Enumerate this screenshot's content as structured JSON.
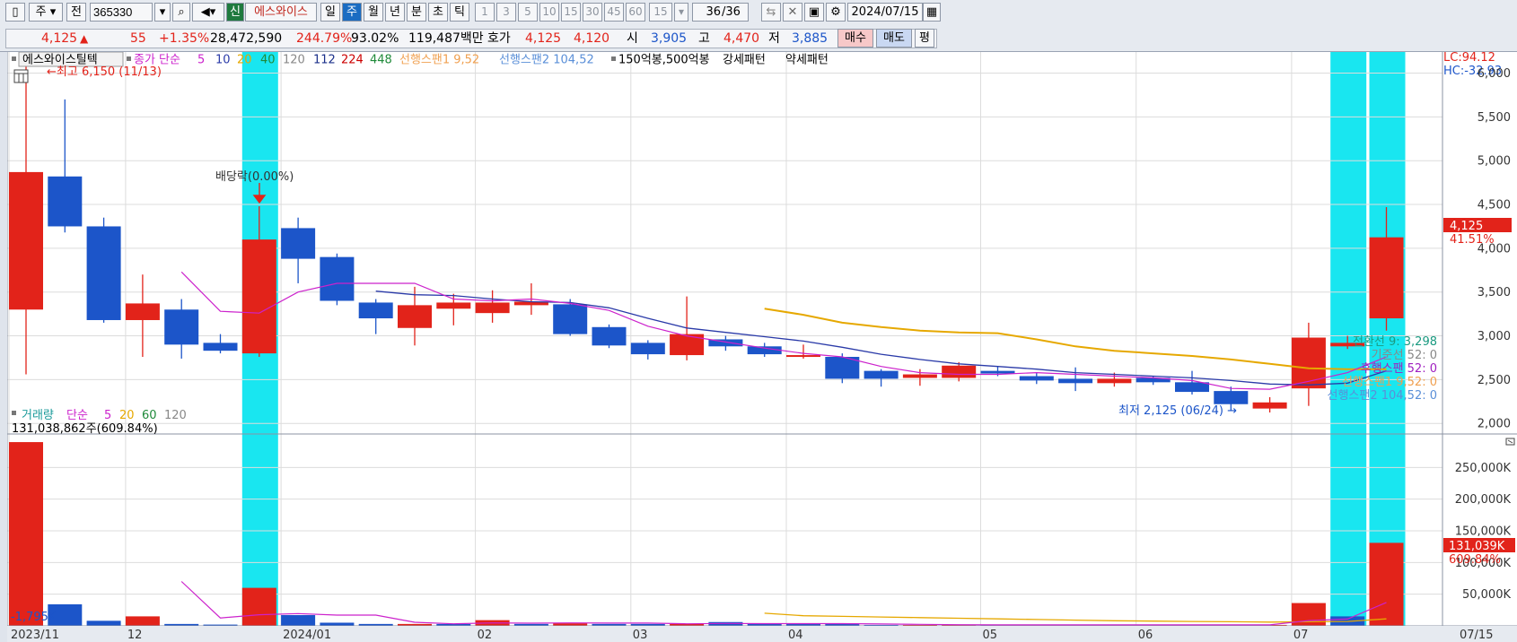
{
  "toolbar": {
    "period_type": "주",
    "prev_label": "전",
    "code": "365330",
    "credit_badge": "신",
    "stock_name": "에스와이스",
    "periods": [
      "일",
      "주",
      "월",
      "년",
      "분",
      "초",
      "틱"
    ],
    "active_period": "주",
    "minute_presets": [
      "1",
      "3",
      "5",
      "10",
      "15",
      "30",
      "45",
      "60"
    ],
    "minute_value": "15",
    "page_current": "36",
    "page_total": "/36",
    "date": "2024/07/15"
  },
  "quote": {
    "price": "4,125",
    "change_arrow": "▲",
    "change": "55",
    "change_pct": "+1.35%",
    "volume": "28,472,590",
    "volume_ratio": "244.79%",
    "turnover": "93.02%",
    "amount": "119,487백만",
    "ask_label": "호가",
    "ask": "4,125",
    "bid": "4,120",
    "open_label": "시",
    "open": "3,905",
    "high_label": "고",
    "high": "4,470",
    "low_label": "저",
    "low": "3,885",
    "buy_label": "매수",
    "sell_label": "매도",
    "eval_label": "평"
  },
  "price_legend": {
    "name": "에스와이스틸텍",
    "ma_label": "종가 단순",
    "ma_periods": [
      "5",
      "10",
      "20",
      "40",
      "120",
      "112",
      "224",
      "448"
    ],
    "span1": "선행스팬1 9,52",
    "span2": "선행스팬2 104,52",
    "pattern1": "150억봉,500억봉",
    "pattern2": "강세패턴",
    "pattern3": "약세패턴"
  },
  "price_annotations": {
    "high_mark": "←최고 6,150 (11/13)",
    "dividend": "배당락(0.00%)",
    "low_mark": "최저 2,125 (06/24) →",
    "lc": "LC:94.12",
    "hc": "HC:-32.93",
    "price_tag": "4,125",
    "price_pct": "41.51%",
    "ichimoku": [
      "전환선 9: 3,298",
      "기준선 52: 0",
      "후행스팬 52: 0",
      "선행스팬1 9,52: 0",
      "선행스팬2 104,52: 0"
    ]
  },
  "volume_legend": {
    "label": "거래량",
    "ma_label": "단순",
    "ma_periods": [
      "5",
      "20",
      "60",
      "120"
    ],
    "current": "131,038,862주(609.84%)",
    "corner_value": "-1,795K",
    "tag": "131,039K",
    "tag_pct": "609.84%"
  },
  "x_axis": {
    "labels": [
      "2023/11",
      "12",
      "2024/01",
      "02",
      "03",
      "04",
      "05",
      "06",
      "07"
    ],
    "last": "07/15"
  },
  "colors": {
    "up": "#e2231a",
    "down": "#1c55c9",
    "highlight": "#19e6f0",
    "ma5": "#cc22cc",
    "ma10": "#2a3aa8",
    "ma20": "#e6a800"
  },
  "chart_data": [
    {
      "type": "candlestick",
      "title": "에스와이스틸텍",
      "x": [
        "2023-11-13",
        "2023-11-20",
        "2023-11-27",
        "2023-12-04",
        "2023-12-11",
        "2023-12-18",
        "2023-12-26",
        "2024-01-02",
        "2024-01-08",
        "2024-01-15",
        "2024-01-22",
        "2024-01-29",
        "2024-02-05",
        "2024-02-13",
        "2024-02-19",
        "2024-02-26",
        "2024-03-04",
        "2024-03-11",
        "2024-03-18",
        "2024-03-25",
        "2024-04-01",
        "2024-04-08",
        "2024-04-15",
        "2024-04-22",
        "2024-04-29",
        "2024-05-06",
        "2024-05-13",
        "2024-05-20",
        "2024-05-27",
        "2024-06-03",
        "2024-06-10",
        "2024-06-17",
        "2024-06-24",
        "2024-07-01",
        "2024-07-08",
        "2024-07-15"
      ],
      "open": [
        3300,
        4820,
        4250,
        3180,
        3300,
        2920,
        2800,
        4230,
        3900,
        3380,
        3090,
        3310,
        3260,
        3350,
        3360,
        3100,
        2920,
        2780,
        2960,
        2880,
        2780,
        2760,
        2600,
        2520,
        2520,
        2600,
        2540,
        2510,
        2460,
        2520,
        2470,
        2370,
        2170,
        2400,
        2880,
        3200
      ],
      "close": [
        4870,
        4250,
        3180,
        3370,
        2900,
        2830,
        4100,
        3880,
        3400,
        3200,
        3350,
        3380,
        3380,
        3390,
        3020,
        2890,
        2790,
        3020,
        2880,
        2790,
        2780,
        2510,
        2510,
        2560,
        2660,
        2570,
        2490,
        2460,
        2510,
        2470,
        2360,
        2220,
        2240,
        2980,
        2920,
        4125
      ],
      "high": [
        6150,
        5700,
        4350,
        3700,
        3420,
        3020,
        4480,
        4350,
        3940,
        3420,
        3560,
        3480,
        3520,
        3600,
        3420,
        3130,
        2950,
        3450,
        3000,
        2920,
        2900,
        2800,
        2620,
        2620,
        2700,
        2650,
        2580,
        2640,
        2580,
        2540,
        2600,
        2420,
        2300,
        3150,
        3000,
        4470
      ],
      "low": [
        2560,
        4180,
        3150,
        2760,
        2740,
        2800,
        2760,
        3600,
        3350,
        3020,
        2890,
        3120,
        3150,
        3240,
        3000,
        2860,
        2730,
        2720,
        2830,
        2760,
        2740,
        2460,
        2420,
        2430,
        2480,
        2540,
        2450,
        2370,
        2420,
        2440,
        2330,
        2150,
        2125,
        2200,
        2850,
        3060
      ],
      "ma5": [
        null,
        null,
        null,
        null,
        3730,
        3280,
        3260,
        3500,
        3600,
        3600,
        3600,
        3420,
        3400,
        3420,
        3370,
        3290,
        3110,
        3000,
        2930,
        2860,
        2800,
        2760,
        2650,
        2580,
        2560,
        2560,
        2580,
        2560,
        2540,
        2520,
        2490,
        2400,
        2390,
        2480,
        2580,
        2760
      ],
      "ma10": [
        null,
        null,
        null,
        null,
        null,
        null,
        null,
        null,
        null,
        3510,
        3470,
        3460,
        3420,
        3390,
        3380,
        3320,
        3200,
        3090,
        3040,
        2990,
        2940,
        2870,
        2790,
        2730,
        2680,
        2650,
        2620,
        2580,
        2560,
        2540,
        2520,
        2490,
        2450,
        2440,
        2460,
        2600
      ],
      "ma20": [
        null,
        null,
        null,
        null,
        null,
        null,
        null,
        null,
        null,
        null,
        null,
        null,
        null,
        null,
        null,
        null,
        null,
        null,
        null,
        3310,
        3240,
        3150,
        3100,
        3060,
        3040,
        3030,
        2960,
        2880,
        2830,
        2800,
        2770,
        2730,
        2680,
        2630,
        2620,
        2620
      ],
      "ylim": [
        1900,
        6200
      ],
      "yticks": [
        2000,
        2500,
        3000,
        3500,
        4000,
        4500,
        5000,
        5500,
        6000
      ],
      "highlighted_weeks": [
        "2023-12-26",
        "2024-07-08",
        "2024-07-15"
      ]
    },
    {
      "type": "bar",
      "title": "거래량",
      "unit": "K",
      "values": [
        290000,
        34000,
        8000,
        15000,
        3000,
        2000,
        60000,
        17000,
        5000,
        3000,
        3000,
        3000,
        9000,
        3000,
        4000,
        3000,
        3000,
        3000,
        6000,
        3000,
        3000,
        3000,
        1500,
        1500,
        1500,
        1500,
        1500,
        1500,
        1500,
        1500,
        1500,
        1500,
        1500,
        36000,
        15000,
        131039
      ],
      "up": [
        true,
        false,
        false,
        true,
        false,
        false,
        true,
        false,
        false,
        false,
        true,
        false,
        true,
        false,
        true,
        false,
        false,
        true,
        false,
        false,
        false,
        false,
        false,
        true,
        true,
        false,
        false,
        false,
        true,
        false,
        false,
        false,
        true,
        true,
        false,
        true
      ],
      "ma5": [
        null,
        null,
        null,
        null,
        70000,
        12400,
        17600,
        19400,
        17000,
        17000,
        5600,
        3200,
        4600,
        4200,
        4600,
        4400,
        4400,
        3200,
        3800,
        3600,
        3600,
        3600,
        3000,
        2400,
        1800,
        1500,
        1500,
        1500,
        1500,
        1500,
        1500,
        1500,
        1500,
        8400,
        10800,
        37000
      ],
      "ma20": [
        null,
        null,
        null,
        null,
        null,
        null,
        null,
        null,
        null,
        null,
        null,
        null,
        null,
        null,
        null,
        null,
        null,
        null,
        null,
        20000,
        16000,
        15000,
        14000,
        13000,
        12000,
        11000,
        10000,
        9000,
        8000,
        7500,
        7000,
        6500,
        6000,
        6500,
        7000,
        11000
      ],
      "ylim": [
        0,
        300000
      ],
      "yticks": [
        50000,
        100000,
        150000,
        200000,
        250000
      ]
    }
  ]
}
